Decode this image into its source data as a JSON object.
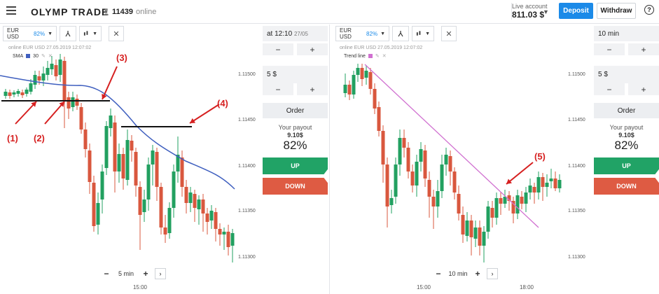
{
  "header": {
    "logo_text": "OLYMP TRADE",
    "online_count": "11439",
    "online_label": "online",
    "account_type": "Live account",
    "balance": "811.03 $",
    "deposit_label": "Deposit",
    "withdraw_label": "Withdraw",
    "help_label": "?"
  },
  "left_panel": {
    "asset_label": "EUR USD",
    "asset_pct": "82%",
    "legend_line": "online EUR USD  27.05.2019 12:07:02",
    "indicator_name": "SMA",
    "indicator_period": "30",
    "indicator_color": "#3f5fbf",
    "price_ticks": [
      "1.11500",
      "1.11450",
      "1.11400",
      "1.11350",
      "1.11300"
    ],
    "time_tick": "15:00",
    "zoom_minus": "−",
    "zoom_label": "5 min",
    "zoom_plus": "+",
    "zoom_next": "›",
    "annotations": [
      "(1)",
      "(2)",
      "(3)",
      "(4)"
    ]
  },
  "left_side": {
    "expiry_value": "at 12:10",
    "expiry_date": "27/05",
    "minus": "−",
    "plus": "+",
    "amount": "5 $",
    "order_label": "Order",
    "payout_label": "Your payout",
    "payout_amount": "9.10$",
    "payout_pct": "82%",
    "up_label": "UP",
    "down_label": "DOWN"
  },
  "right_panel": {
    "asset_label": "EUR USD",
    "asset_pct": "82%",
    "legend_line": "online EUR USD  27.05.2019 12:07:02",
    "indicator_name": "Trend line",
    "indicator_color": "#d070d0",
    "price_ticks": [
      "1.11500",
      "1.11450",
      "1.11400",
      "1.11350",
      "1.11300"
    ],
    "time_ticks": [
      "15:00",
      "18:00"
    ],
    "zoom_minus": "−",
    "zoom_label": "10 min",
    "zoom_plus": "+",
    "zoom_next": "›",
    "annotations": [
      "(5)"
    ]
  },
  "right_side": {
    "expiry_value": "10 min",
    "minus": "−",
    "plus": "+",
    "amount": "5 $",
    "order_label": "Order",
    "payout_label": "Your payout",
    "payout_amount": "9.10$",
    "payout_pct": "82%",
    "up_label": "UP",
    "down_label": "DOWN"
  },
  "colors": {
    "up_candle": "#22a060",
    "down_candle": "#d9573e",
    "annotation": "#d62020",
    "accent": "#1b8ae8"
  }
}
